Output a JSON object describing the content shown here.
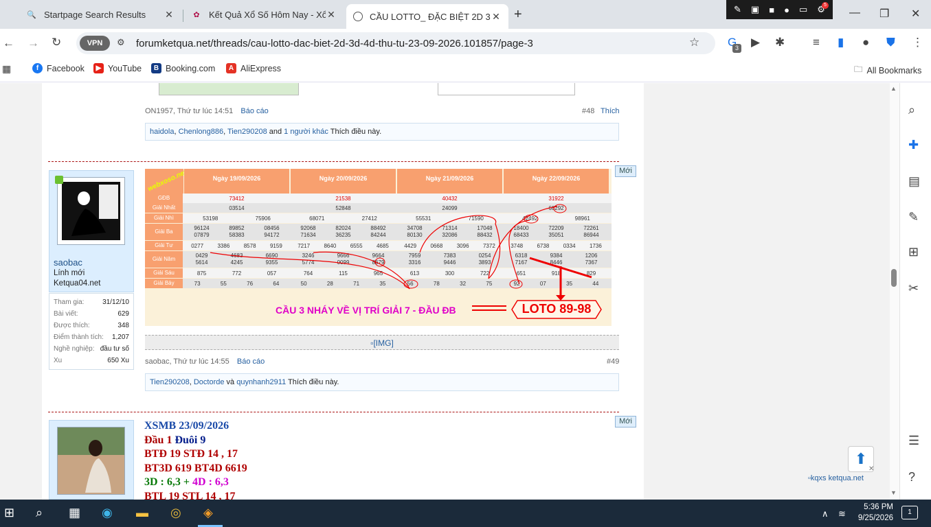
{
  "tabs": [
    {
      "title": "Startpage Search Results"
    },
    {
      "title": "Kết Quả Xổ Số Hôm Nay - Xổ Số"
    },
    {
      "title": "CẦU LOTTO_ ĐẶC BIỆT 2D 3D 4"
    }
  ],
  "screen_tools": {
    "badge": "5"
  },
  "toolbar": {
    "vpn": "VPN",
    "url": "forumketqua.net/threads/cau-lotto-dac-biet-2d-3d-4d-thu-tu-23-09-2026.101857/page-3",
    "ext_badge": "3"
  },
  "bookmarks": [
    {
      "label": "Facebook"
    },
    {
      "label": "YouTube"
    },
    {
      "label": "Booking.com"
    },
    {
      "label": "AliExpress"
    }
  ],
  "all_bookmarks": "All Bookmarks",
  "post48": {
    "author": "ON1957",
    "time": "Thứ tư lúc 14:51",
    "report": "Báo cáo",
    "num": "#48",
    "like": "Thích",
    "likers": [
      "haidola",
      "Chenlong886",
      "Tien290208"
    ],
    "sep1": ", ",
    "sep2": ", ",
    "and": " and ",
    "others": "1 người khác",
    "suffix": " Thích điều này."
  },
  "new_label": "Mới",
  "post49": {
    "username": "saobac",
    "title": "Lính mới",
    "site": "Ketqua04.net",
    "stats": [
      {
        "k": "Tham gia:",
        "v": "31/12/10"
      },
      {
        "k": "Bài viết:",
        "v": "629"
      },
      {
        "k": "Được thích:",
        "v": "348"
      },
      {
        "k": "Điểm thành tích:",
        "v": "1,207"
      },
      {
        "k": "Nghề nghiệp:",
        "v": "đầu tư số"
      },
      {
        "k": "Xu",
        "v": "650 Xu"
      }
    ],
    "img_alt": "[IMG]",
    "author": "saobac",
    "time": "Thứ tư lúc 14:55",
    "report": "Báo cáo",
    "num": "#49",
    "likers": [
      "Tien290208",
      "Doctorde"
    ],
    "sep": ", ",
    "and": " và ",
    "last": "quynhanh2911",
    "suffix": " Thích điều này."
  },
  "lotto": {
    "watermark": "webxoso.net",
    "days": [
      "Ngày 19/09/2026",
      "Ngày 20/09/2026",
      "Ngày 21/09/2026",
      "Ngày 22/09/2026"
    ],
    "labels": [
      "GĐB",
      "Giải Nhất",
      "Giải Nhì",
      "Giải Ba",
      "Giải Tư",
      "Giải Năm",
      "Giải Sáu",
      "Giải Bảy"
    ],
    "caption": "CẦU 3 NHÁY VỀ VỊ TRÍ GIẢI 7 - ĐẦU ĐB",
    "result": "LOTO 89-98",
    "cols": [
      {
        "gdb": "73412",
        "g1": "03514",
        "g2": [
          "53198",
          "75906"
        ],
        "g3": [
          "96124",
          "89852",
          "08456",
          "07879",
          "58383",
          "94172"
        ],
        "g4": [
          "0277",
          "3386",
          "8578",
          "9159"
        ],
        "g5": [
          "0429",
          "4683",
          "6690",
          "5614",
          "4245",
          "9355"
        ],
        "g6": [
          "875",
          "772",
          "057"
        ],
        "g7": [
          "73",
          "55",
          "76",
          "64"
        ]
      },
      {
        "gdb": "21538",
        "g1": "52848",
        "g2": [
          "68071",
          "27412"
        ],
        "g3": [
          "92068",
          "82024",
          "88492",
          "71634",
          "36235",
          "84244"
        ],
        "g4": [
          "7217",
          "8640",
          "6555",
          "4685"
        ],
        "g5": [
          "3246",
          "9666",
          "9664",
          "5774",
          "0099",
          "8679"
        ],
        "g6": [
          "764",
          "115",
          "965"
        ],
        "g7": [
          "50",
          "28",
          "71",
          "35"
        ]
      },
      {
        "gdb": "40432",
        "g1": "24099",
        "g2": [
          "55531",
          "71590"
        ],
        "g3": [
          "34708",
          "71314",
          "17048",
          "80130",
          "32086",
          "88432"
        ],
        "g4": [
          "4429",
          "0668",
          "3096",
          "7372"
        ],
        "g5": [
          "7959",
          "7383",
          "0254",
          "3316",
          "9446",
          "3893"
        ],
        "g6": [
          "613",
          "300",
          "722"
        ],
        "g7": [
          "56",
          "78",
          "32",
          "75"
        ]
      },
      {
        "gdb": "31922",
        "g1": "68292",
        "g2": [
          "42492",
          "98961"
        ],
        "g3": [
          "18400",
          "72209",
          "72261",
          "68433",
          "35051",
          "86944"
        ],
        "g4": [
          "3748",
          "6738",
          "0334",
          "1736"
        ],
        "g5": [
          "6318",
          "9384",
          "1206",
          "7167",
          "8446",
          "7367"
        ],
        "g6": [
          "651",
          "918",
          "829"
        ],
        "g7": [
          "92",
          "07",
          "35",
          "44"
        ]
      }
    ]
  },
  "post50": {
    "lines": [
      {
        "parts": [
          {
            "t": "XSMB 23/09/2026",
            "c": "#1a4aa8"
          }
        ]
      },
      {
        "parts": [
          {
            "t": "Đầu 1 ",
            "c": "#a00"
          },
          {
            "t": "Đuôi 9",
            "c": "#001b8a"
          }
        ]
      },
      {
        "parts": [
          {
            "t": "BTĐ 19 STĐ 14 , 17",
            "c": "#b00000"
          }
        ]
      },
      {
        "parts": [
          {
            "t": "BT3D 619 BT4D 6619",
            "c": "#b00000"
          }
        ]
      },
      {
        "parts": [
          {
            "t": "3D : 6,3 ",
            "c": "#0a7a0a"
          },
          {
            "t": "+ ",
            "c": "#0a7a0a"
          },
          {
            "t": "4D : 6,3",
            "c": "#d000d0"
          }
        ]
      },
      {
        "parts": [
          {
            "t": "BTL 19 STL 14 , 17",
            "c": "#b00000"
          }
        ]
      }
    ]
  },
  "float_link": "kqxs ketqua.net",
  "clock": {
    "time": "5:36 PM",
    "date": "9/25/2026"
  },
  "notify_count": "1"
}
